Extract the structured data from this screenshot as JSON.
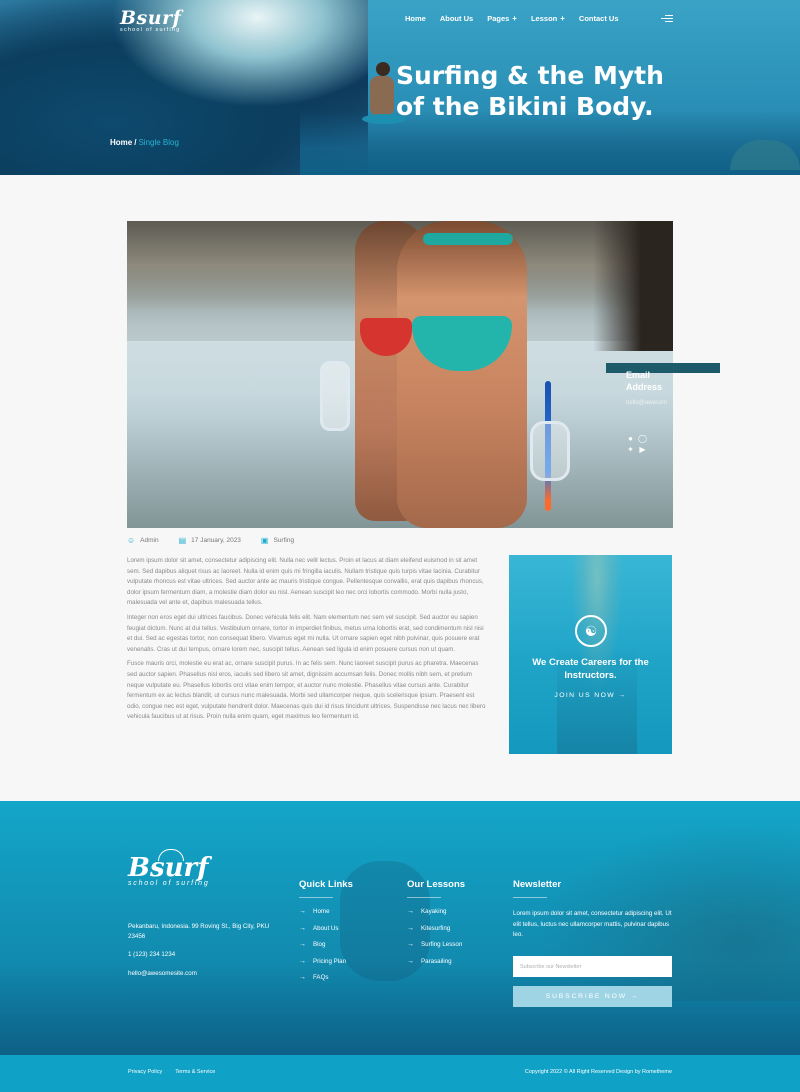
{
  "brand": {
    "name": "Bsurf",
    "tagline": "school of surfing"
  },
  "nav": {
    "items": [
      {
        "label": "Home",
        "has_plus": false
      },
      {
        "label": "About Us",
        "has_plus": false
      },
      {
        "label": "Pages",
        "has_plus": true
      },
      {
        "label": "Lesson",
        "has_plus": true
      },
      {
        "label": "Contact Us",
        "has_plus": false
      }
    ],
    "plus_symbol": "+",
    "menu_icon": "hamburger-icon"
  },
  "hero": {
    "title": "Surfing & the Myth of the Bikini Body.",
    "breadcrumb": {
      "home": "Home",
      "separator": "/",
      "current": "Single Blog"
    }
  },
  "image_overlay": {
    "label": "Email Address",
    "email": "hello@awesom",
    "social_icons": [
      "facebook-icon",
      "instagram-icon",
      "twitter-icon",
      "youtube-icon"
    ]
  },
  "meta": {
    "author": "Admin",
    "date": "17 January, 2023",
    "category": "Surfing"
  },
  "article": {
    "paragraphs": [
      "Lorem ipsum dolor sit amet, consectetur adipiscing elit. Nulla nec velit lectus. Proin et lacus at diam eleifend euismod in sit amet sem. Sed dapibus aliquet risus ac laoreet. Nulla id enim quis mi fringilla iaculis. Nullam tristique quis turpis vitae lacinia. Curabitur vulputate rhoncus est vitae ultrices. Sed auctor ante ac mauris tristique congue. Pellentesque convallis, erat quis dapibus rhoncus, dolor ipsum fermentum diam, a molestie diam dolor eu nisl. Aenean suscipit leo nec orci lobortis commodo. Morbi nulla justo, malesuada vel ante et, dapibus malesuada tellus.",
      "Integer non eros eget dui ultrices faucibus. Donec vehicula felis elit. Nam elementum nec sem vel suscipit. Sed auctor eu sapien feugiat dictum. Nunc at dui tellus. Vestibulum ornare, tortor in imperdiet finibus, metus urna lobortis erat, sed condimentum nisl nisi et dui. Sed ac egestas tortor, non consequat libero. Vivamus eget mi nulla. Ut ornare sapien eget nibh pulvinar, quis posuere erat venenatis. Cras ut dui tempus, ornare lorem nec, suscipit tellus. Aenean sed ligula id enim posuere cursus non ut quam.",
      "Fusce mauris orci, molestie eu erat ac, ornare suscipit purus. In ac felis sem. Nunc laoreet suscipit purus ac pharetra. Maecenas sed auctor sapien. Phasellus nisl eros, iaculis sed libero sit amet, dignissim accumsan felis. Donec mollis nibh sem, et pretium neque vulputate eu. Phasellus lobortis orci vitae enim tempor, et auctor nunc molestie. Phasellus vitae cursus ante. Curabitur fermentum ex ac lectus blandit, ut cursus nunc malesuada. Morbi sed ullamcorper neque, quis scelerisque ipsum. Praesent est odio, congue nec est eget, vulputate hendrerit dolor. Maecenas quis dui id risus tincidunt ultrices. Suspendisse nec lacus nec libero vehicula faucibus ut at risus. Proin nulla enim quam, eget maximus leo fermentum id."
    ]
  },
  "sidebar_card": {
    "icon": "instructor-icon",
    "title": "We Create Careers for the Instructors.",
    "cta": "JOIN US NOW →"
  },
  "footer": {
    "address": "Pekanbaru, Indonesia. 99 Roving St., Big City, PKU 23456",
    "phone": "1 (123) 234 1234",
    "email": "hello@awesomesite.com",
    "quick_links": {
      "heading": "Quick Links",
      "items": [
        "Home",
        "About Us",
        "Blog",
        "Pricing Plan",
        "FAQs"
      ]
    },
    "lessons": {
      "heading": "Our Lessons",
      "items": [
        "Kayaking",
        "Kitesurfing",
        "Surfing Lesson",
        "Parasailing"
      ]
    },
    "newsletter": {
      "heading": "Newsletter",
      "text": "Lorem ipsum dolor sit amet, consectetur adipiscing elit. Ut elit tellus, luctus nec ullamcorper mattis, pulvinar dapibus leo.",
      "placeholder": "Subscribe our Newsletter",
      "button": "SUBSCRIBE NOW →"
    },
    "bottom": {
      "links": [
        "Privacy Policy",
        "Terms & Service"
      ],
      "copyright": "Copyright 2022 © All Right Reserved Design by Rometheme"
    },
    "arrow": "→"
  },
  "colors": {
    "accent": "#1faed0",
    "footer_bg": "#13a6c9",
    "overlay_bar": "#1d5b6b"
  }
}
